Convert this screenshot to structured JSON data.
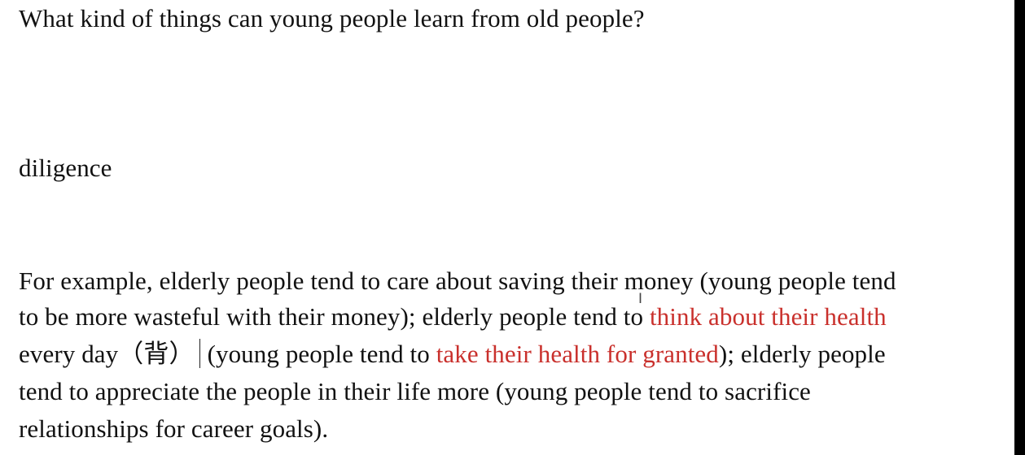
{
  "question": "What kind of things can young people learn from old people?",
  "keyword": "diligence",
  "paragraph": {
    "line1": "For example, elderly people tend to care about saving their money (young people tend",
    "line2_a": "to be more wasteful with their money); elderly people tend to ",
    "line2_red": "think about their health",
    "line3_a": "every day（背）",
    "line3_b": "(young people tend to ",
    "line3_red": "take their health for granted",
    "line3_c": "); elderly people",
    "line4": "tend to appreciate the people in their life more (young people tend to sacrifice",
    "line5": "relationships for career goals)."
  },
  "colors": {
    "highlight": "#c9302c",
    "text": "#111111"
  },
  "cursor_icon": "text-cursor-ibeam-icon"
}
